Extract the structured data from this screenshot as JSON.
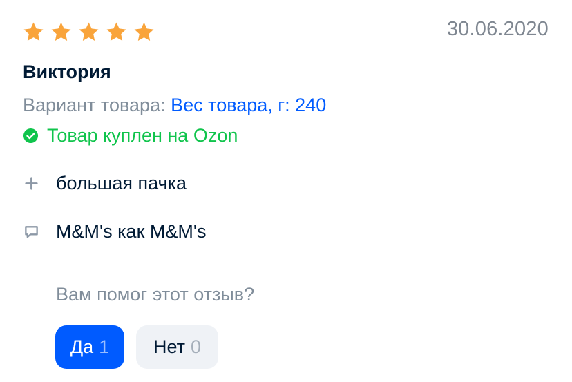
{
  "review": {
    "rating": 5,
    "rating_max": 5,
    "date": "30.06.2020",
    "author": "Виктория",
    "variant": {
      "label": "Вариант товара:",
      "value": "Вес товара, г: 240"
    },
    "verified_purchase": "Товар куплен на Ozon",
    "pros": "большая пачка",
    "comment": "M&M's как M&M's",
    "helpful": {
      "question": "Вам помог этот отзыв?",
      "yes_label": "Да",
      "yes_count": "1",
      "no_label": "Нет",
      "no_count": "0"
    }
  },
  "colors": {
    "star": "#f9a43b",
    "accent": "#005bff",
    "verified": "#10c44c",
    "muted": "#808d9a",
    "text": "#001a34"
  },
  "icons": {
    "star": "star-icon",
    "verified": "check-circle-icon",
    "pros": "plus-icon",
    "comment": "comment-icon"
  }
}
